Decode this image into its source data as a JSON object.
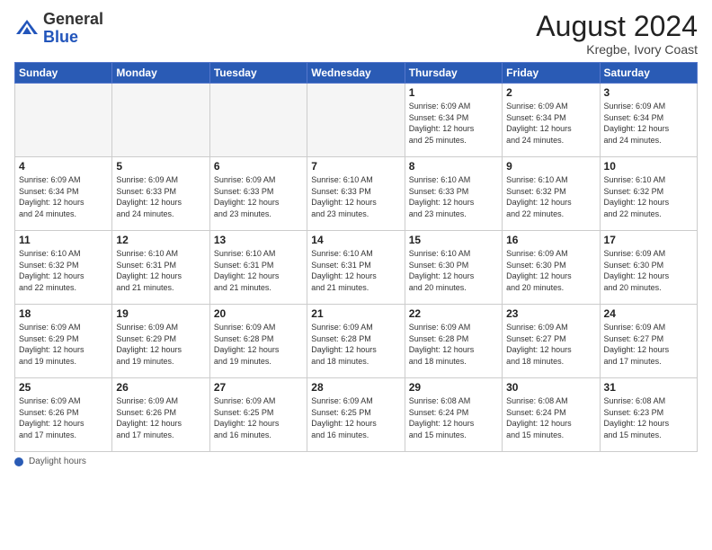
{
  "logo": {
    "general": "General",
    "blue": "Blue"
  },
  "header": {
    "month_year": "August 2024",
    "location": "Kregbe, Ivory Coast"
  },
  "days_of_week": [
    "Sunday",
    "Monday",
    "Tuesday",
    "Wednesday",
    "Thursday",
    "Friday",
    "Saturday"
  ],
  "footer": {
    "label": "Daylight hours"
  },
  "weeks": [
    [
      {
        "day": "",
        "info": ""
      },
      {
        "day": "",
        "info": ""
      },
      {
        "day": "",
        "info": ""
      },
      {
        "day": "",
        "info": ""
      },
      {
        "day": "1",
        "info": "Sunrise: 6:09 AM\nSunset: 6:34 PM\nDaylight: 12 hours\nand 25 minutes."
      },
      {
        "day": "2",
        "info": "Sunrise: 6:09 AM\nSunset: 6:34 PM\nDaylight: 12 hours\nand 24 minutes."
      },
      {
        "day": "3",
        "info": "Sunrise: 6:09 AM\nSunset: 6:34 PM\nDaylight: 12 hours\nand 24 minutes."
      }
    ],
    [
      {
        "day": "4",
        "info": "Sunrise: 6:09 AM\nSunset: 6:34 PM\nDaylight: 12 hours\nand 24 minutes."
      },
      {
        "day": "5",
        "info": "Sunrise: 6:09 AM\nSunset: 6:33 PM\nDaylight: 12 hours\nand 24 minutes."
      },
      {
        "day": "6",
        "info": "Sunrise: 6:09 AM\nSunset: 6:33 PM\nDaylight: 12 hours\nand 23 minutes."
      },
      {
        "day": "7",
        "info": "Sunrise: 6:10 AM\nSunset: 6:33 PM\nDaylight: 12 hours\nand 23 minutes."
      },
      {
        "day": "8",
        "info": "Sunrise: 6:10 AM\nSunset: 6:33 PM\nDaylight: 12 hours\nand 23 minutes."
      },
      {
        "day": "9",
        "info": "Sunrise: 6:10 AM\nSunset: 6:32 PM\nDaylight: 12 hours\nand 22 minutes."
      },
      {
        "day": "10",
        "info": "Sunrise: 6:10 AM\nSunset: 6:32 PM\nDaylight: 12 hours\nand 22 minutes."
      }
    ],
    [
      {
        "day": "11",
        "info": "Sunrise: 6:10 AM\nSunset: 6:32 PM\nDaylight: 12 hours\nand 22 minutes."
      },
      {
        "day": "12",
        "info": "Sunrise: 6:10 AM\nSunset: 6:31 PM\nDaylight: 12 hours\nand 21 minutes."
      },
      {
        "day": "13",
        "info": "Sunrise: 6:10 AM\nSunset: 6:31 PM\nDaylight: 12 hours\nand 21 minutes."
      },
      {
        "day": "14",
        "info": "Sunrise: 6:10 AM\nSunset: 6:31 PM\nDaylight: 12 hours\nand 21 minutes."
      },
      {
        "day": "15",
        "info": "Sunrise: 6:10 AM\nSunset: 6:30 PM\nDaylight: 12 hours\nand 20 minutes."
      },
      {
        "day": "16",
        "info": "Sunrise: 6:09 AM\nSunset: 6:30 PM\nDaylight: 12 hours\nand 20 minutes."
      },
      {
        "day": "17",
        "info": "Sunrise: 6:09 AM\nSunset: 6:30 PM\nDaylight: 12 hours\nand 20 minutes."
      }
    ],
    [
      {
        "day": "18",
        "info": "Sunrise: 6:09 AM\nSunset: 6:29 PM\nDaylight: 12 hours\nand 19 minutes."
      },
      {
        "day": "19",
        "info": "Sunrise: 6:09 AM\nSunset: 6:29 PM\nDaylight: 12 hours\nand 19 minutes."
      },
      {
        "day": "20",
        "info": "Sunrise: 6:09 AM\nSunset: 6:28 PM\nDaylight: 12 hours\nand 19 minutes."
      },
      {
        "day": "21",
        "info": "Sunrise: 6:09 AM\nSunset: 6:28 PM\nDaylight: 12 hours\nand 18 minutes."
      },
      {
        "day": "22",
        "info": "Sunrise: 6:09 AM\nSunset: 6:28 PM\nDaylight: 12 hours\nand 18 minutes."
      },
      {
        "day": "23",
        "info": "Sunrise: 6:09 AM\nSunset: 6:27 PM\nDaylight: 12 hours\nand 18 minutes."
      },
      {
        "day": "24",
        "info": "Sunrise: 6:09 AM\nSunset: 6:27 PM\nDaylight: 12 hours\nand 17 minutes."
      }
    ],
    [
      {
        "day": "25",
        "info": "Sunrise: 6:09 AM\nSunset: 6:26 PM\nDaylight: 12 hours\nand 17 minutes."
      },
      {
        "day": "26",
        "info": "Sunrise: 6:09 AM\nSunset: 6:26 PM\nDaylight: 12 hours\nand 17 minutes."
      },
      {
        "day": "27",
        "info": "Sunrise: 6:09 AM\nSunset: 6:25 PM\nDaylight: 12 hours\nand 16 minutes."
      },
      {
        "day": "28",
        "info": "Sunrise: 6:09 AM\nSunset: 6:25 PM\nDaylight: 12 hours\nand 16 minutes."
      },
      {
        "day": "29",
        "info": "Sunrise: 6:08 AM\nSunset: 6:24 PM\nDaylight: 12 hours\nand 15 minutes."
      },
      {
        "day": "30",
        "info": "Sunrise: 6:08 AM\nSunset: 6:24 PM\nDaylight: 12 hours\nand 15 minutes."
      },
      {
        "day": "31",
        "info": "Sunrise: 6:08 AM\nSunset: 6:23 PM\nDaylight: 12 hours\nand 15 minutes."
      }
    ]
  ]
}
